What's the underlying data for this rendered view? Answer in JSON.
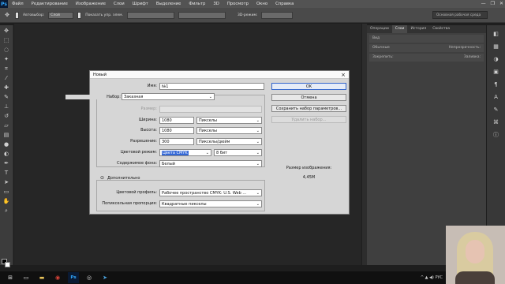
{
  "menubar": {
    "logo": "Ps",
    "items": [
      "Файл",
      "Редактирование",
      "Изображение",
      "Слои",
      "Шрифт",
      "Выделение",
      "Фильтр",
      "3D",
      "Просмотр",
      "Окно",
      "Справка"
    ],
    "controls": [
      "—",
      "❐",
      "✕"
    ]
  },
  "optionsbar": {
    "autoselect": "Автовыбор:",
    "layer_select": "Слой",
    "show_controls": "Показать упр. элем.",
    "mode_3d": "3D-режим:"
  },
  "workspace": {
    "label": "Основная рабочая среда"
  },
  "panels": {
    "tabs": [
      "Операции",
      "Слои",
      "История",
      "Свойства"
    ],
    "active_tab": "Слои",
    "kind": "Вид",
    "blend_mode": "Обычные",
    "opacity_label": "Непрозрачность:",
    "lock_label": "Закрепить:",
    "fill_label": "Заливка:"
  },
  "dialog": {
    "title": "Новый",
    "close": "×",
    "name_label": "Имя:",
    "name_value": "№1",
    "preset_label": "Набор:",
    "preset_value": "Заказная",
    "size_label": "Размер:",
    "width_label": "Ширина:",
    "width_value": "1080",
    "width_unit": "Пикселы",
    "height_label": "Высота:",
    "height_value": "1080",
    "height_unit": "Пикселы",
    "resolution_label": "Разрешение:",
    "resolution_value": "300",
    "resolution_unit": "Пикселы/дюйм",
    "color_mode_label": "Цветовой режим:",
    "color_mode_value": "Цвета CMYK",
    "bit_depth": "8 бит",
    "background_label": "Содержимое фона:",
    "background_value": "Белый",
    "advanced_label": "Дополнительно",
    "color_profile_label": "Цветовой профиль:",
    "color_profile_value": "Рабочее пространство CMYK:  U.S. Web ...",
    "pixel_aspect_label": "Попиксельная пропорция:",
    "pixel_aspect_value": "Квадратные пикселы",
    "ok_button": "OK",
    "cancel_button": "Отмена",
    "save_preset_button": "Сохранить набор параметров...",
    "delete_preset_button": "Удалить набор...",
    "image_size_label": "Размер изображения:",
    "image_size_value": "4,45M"
  },
  "taskbar": {
    "ps": "Ps",
    "tray": "^  ▲  ◀)  РУС"
  }
}
